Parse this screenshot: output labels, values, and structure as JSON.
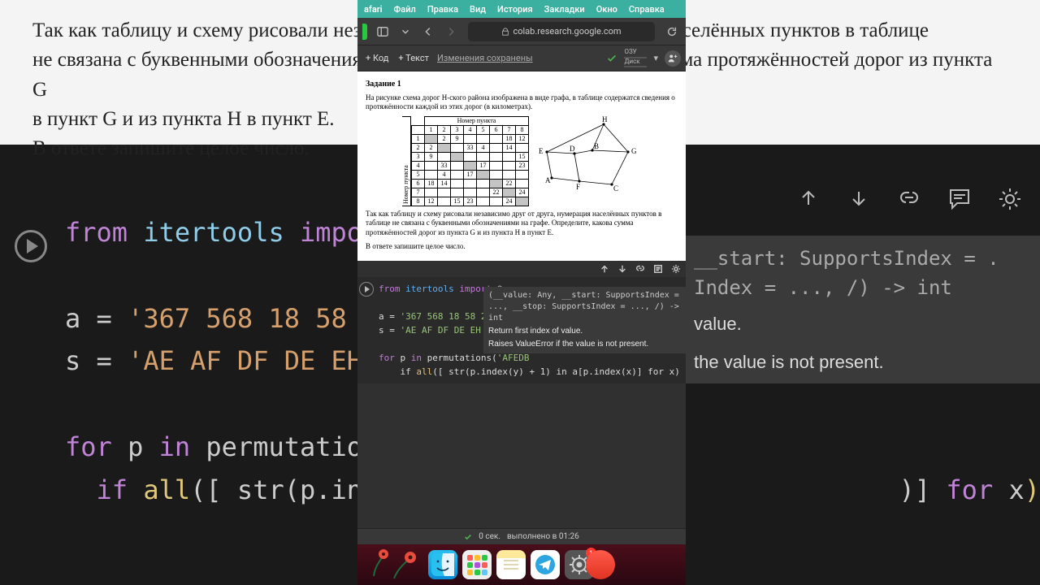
{
  "mac_menu": {
    "app": "afari",
    "items": [
      "Файл",
      "Правка",
      "Вид",
      "История",
      "Закладки",
      "Окно",
      "Справка"
    ]
  },
  "safari": {
    "url": "colab.research.google.com"
  },
  "colab": {
    "code_btn": "+ Код",
    "text_btn": "+ Текст",
    "save_state": "Изменения сохранены",
    "ram": "ОЗУ",
    "disk": "Диск"
  },
  "doc": {
    "title": "Задание 1",
    "para1": "На рисунке схема дорог Н-ского района изображена в виде графа, в таблице содержатся сведения о протяжённости каждой из этих дорог (в километрах).",
    "col_header": "Номер пункта",
    "row_header": "Номер пункта",
    "cols": [
      "",
      "1",
      "2",
      "3",
      "4",
      "5",
      "6",
      "7",
      "8"
    ],
    "rows": [
      [
        "1",
        "",
        "2",
        "9",
        "",
        "",
        "",
        "18",
        "12"
      ],
      [
        "2",
        "2",
        "",
        "",
        "33",
        "4",
        "",
        "14",
        ""
      ],
      [
        "3",
        "9",
        "",
        "",
        "",
        "",
        "",
        "",
        "15"
      ],
      [
        "4",
        "",
        "33",
        "",
        "",
        "17",
        "",
        "",
        "23"
      ],
      [
        "5",
        "",
        "4",
        "",
        "17",
        "",
        "",
        "",
        ""
      ],
      [
        "6",
        "18",
        "14",
        "",
        "",
        "",
        "",
        "22",
        ""
      ],
      [
        "7",
        "",
        "",
        "",
        "",
        "",
        "22",
        "",
        "24"
      ],
      [
        "8",
        "12",
        "",
        "15",
        "23",
        "",
        "",
        "24",
        ""
      ]
    ],
    "para2": "Так как таблицу и схему рисовали независимо друг от друга, нумерация населённых пунктов в таблице не связана с буквенными обозначениями на графе. Определите, какова сумма протяжённостей дорог из пункта G и из пункта H в пункт E.",
    "para3": "В ответе запишите целое число.",
    "graph_nodes": [
      "A",
      "B",
      "C",
      "D",
      "E",
      "F",
      "G",
      "H"
    ]
  },
  "code": {
    "l1_from": "from",
    "l1_mod": "itertools",
    "l1_imp": "import",
    "l1_star": "*",
    "l3_a": "a = ",
    "l3_val": "'367 568 18 58 247 127 1",
    "l4_s": "s = ",
    "l4_val": "'AE AF DF DE EH BD BG GH",
    "l6_for": "for",
    "l6_p": " p ",
    "l6_in": "in",
    "l6_perm": " permutations(",
    "l6_arg": "'AFEDB",
    "l7_if": "    if ",
    "l7_all": "all",
    "l7_open": "(",
    "l7_body": "[ str(p.index(y) + 1) in a[p.index(x)] for x)"
  },
  "hint": {
    "sig": "(__value: Any, __start: SupportsIndex = ..., __stop: SupportsIndex = ..., /) -> int",
    "d1": "Return first index of value.",
    "d2": "Raises ValueError if the value is not present."
  },
  "status": {
    "time": "0 сек.",
    "ran": "выполнено в 01:26"
  },
  "dock": {
    "badge": "1"
  },
  "bg_doc": {
    "l1": "Так как таблицу и схему рисовали независимо друг от друга, нумерация населённых пунктов в таблице",
    "l2": "не связана с буквенными обозначениями на графе. Определите, какова сумма протяжённостей дорог из пункта G",
    "l3": "в пункт G и из пункта H в пункт E.",
    "l4": "В ответе запишите целое число."
  },
  "bg_hint": {
    "sig1": "__start: SupportsIndex = .",
    "sig2": "Index = ..., /) -> int",
    "d1": "value.",
    "d2": "the value is not present."
  }
}
